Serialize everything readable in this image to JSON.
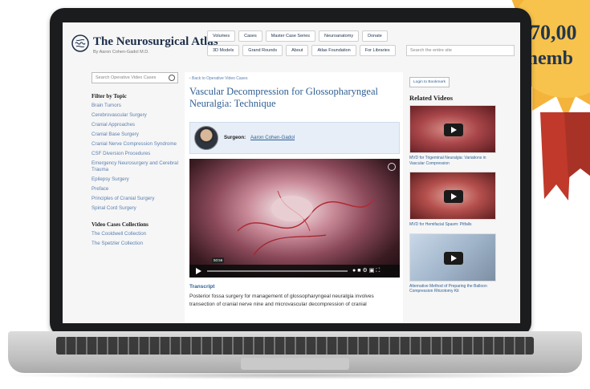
{
  "site": {
    "brand": "The Neurosurgical Atlas",
    "byline": "By Aaron Cohen-Gadol M.D.",
    "search_placeholder": "Search the entire site"
  },
  "nav": {
    "items": [
      "Volumes",
      "Cases",
      "Master Case Series",
      "Neuroanatomy",
      "Donate",
      "3D Models",
      "Grand Rounds",
      "About",
      "Atlas Foundation",
      "For Libraries"
    ]
  },
  "sidebar": {
    "search_placeholder": "Search Operative Video Cases",
    "filter_heading": "Filter by Topic",
    "topics": [
      "Brain Tumors",
      "Cerebrovascular Surgery",
      "Cranial Approaches",
      "Cranial Base Surgery",
      "Cranial Nerve Compression Syndrome",
      "CSF Diversion Procedures",
      "Emergency Neurosurgery and Cerebral Trauma",
      "Epilepsy Surgery",
      "Preface",
      "Principles of Cranial Surgery",
      "Spinal Cord Surgery"
    ],
    "collections_heading": "Video Cases Collections",
    "collections": [
      "The Cooldwell Collection",
      "The Spetzler Collection"
    ]
  },
  "main": {
    "back_link": "‹ Back to Operative Video Cases",
    "title": "Vascular Decompression for Glossopharyngeal Neuralgia: Technique",
    "surgeon_label": "Surgeon:",
    "surgeon_name": "Aaron Cohen-Gadol",
    "video_time": "50:56",
    "transcript_heading": "Transcript",
    "transcript_text": "Posterior fossa surgery for management of glossopharyngeal neuralgia involves transection of cranial nerve nine and microvascular decompression of cranial"
  },
  "right": {
    "bookmark": "Login to Bookmark",
    "related_heading": "Related Videos",
    "videos": [
      "MVD for Trigeminal Neuralgia: Variations in Vascular Compression",
      "MVD for Hemifacial Spasm: Pitfalls",
      "Alternative Method of Preparing the Balloon Compression Rhizotomy Kit"
    ]
  },
  "badge": {
    "line1": "70,00",
    "line2": "memb"
  }
}
